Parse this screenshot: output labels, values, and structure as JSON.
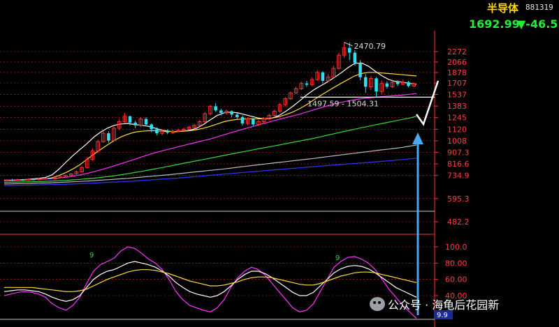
{
  "header": {
    "name": "半导体",
    "code": "881319",
    "price": "1692.99",
    "change": "▼-46.5"
  },
  "watermark": {
    "text": "公众号 · 海龟后花园新"
  },
  "colors": {
    "up": "#ff3333",
    "down": "#33ddee",
    "grid": "#ff3333",
    "axis_text": "#ff4040",
    "ma_white": "#ffffff",
    "ma_yellow": "#ffdd33",
    "ma_magenta": "#ff33ff",
    "ma_green": "#33dd33",
    "ma_gray": "#bbbbbb",
    "ma_blue": "#3333ff",
    "arrow": "#4aa8f0"
  },
  "chart_data": {
    "type": "candlestick",
    "price_axis": {
      "scale": "log",
      "ticks": [
        "2272",
        "2066",
        "1878",
        "1707",
        "1537",
        "1383",
        "1245",
        "1120",
        "1008",
        "907.3",
        "816.6",
        "734.9",
        "595.3",
        "482.2"
      ]
    },
    "annotations": {
      "high_label": "2470.79",
      "range_label": "1497.59 - 1504.31",
      "support_level": 1500,
      "support_line_label": "1537"
    },
    "candles": [
      {
        "o": 700,
        "c": 705,
        "h": 710,
        "l": 695
      },
      {
        "o": 705,
        "c": 702,
        "h": 712,
        "l": 698
      },
      {
        "o": 702,
        "c": 708,
        "h": 714,
        "l": 699
      },
      {
        "o": 708,
        "c": 704,
        "h": 712,
        "l": 700
      },
      {
        "o": 704,
        "c": 710,
        "h": 716,
        "l": 701
      },
      {
        "o": 710,
        "c": 706,
        "h": 714,
        "l": 702
      },
      {
        "o": 706,
        "c": 712,
        "h": 718,
        "l": 703
      },
      {
        "o": 712,
        "c": 716,
        "h": 722,
        "l": 708
      },
      {
        "o": 716,
        "c": 713,
        "h": 720,
        "l": 710
      },
      {
        "o": 713,
        "c": 720,
        "h": 726,
        "l": 710
      },
      {
        "o": 720,
        "c": 726,
        "h": 732,
        "l": 716
      },
      {
        "o": 726,
        "c": 735,
        "h": 742,
        "l": 722
      },
      {
        "o": 735,
        "c": 745,
        "h": 752,
        "l": 730
      },
      {
        "o": 745,
        "c": 760,
        "h": 768,
        "l": 740
      },
      {
        "o": 760,
        "c": 790,
        "h": 800,
        "l": 755
      },
      {
        "o": 790,
        "c": 850,
        "h": 870,
        "l": 785
      },
      {
        "o": 850,
        "c": 920,
        "h": 940,
        "l": 840
      },
      {
        "o": 920,
        "c": 1000,
        "h": 1020,
        "l": 905
      },
      {
        "o": 1000,
        "c": 1080,
        "h": 1100,
        "l": 990
      },
      {
        "o": 1080,
        "c": 1010,
        "h": 1100,
        "l": 990
      },
      {
        "o": 1010,
        "c": 1130,
        "h": 1150,
        "l": 1000
      },
      {
        "o": 1130,
        "c": 1200,
        "h": 1230,
        "l": 1110
      },
      {
        "o": 1200,
        "c": 1260,
        "h": 1300,
        "l": 1180
      },
      {
        "o": 1260,
        "c": 1190,
        "h": 1270,
        "l": 1160
      },
      {
        "o": 1190,
        "c": 1160,
        "h": 1210,
        "l": 1130
      },
      {
        "o": 1160,
        "c": 1230,
        "h": 1250,
        "l": 1140
      },
      {
        "o": 1230,
        "c": 1170,
        "h": 1250,
        "l": 1150
      },
      {
        "o": 1170,
        "c": 1120,
        "h": 1180,
        "l": 1090
      },
      {
        "o": 1120,
        "c": 1080,
        "h": 1140,
        "l": 1060
      },
      {
        "o": 1080,
        "c": 1100,
        "h": 1120,
        "l": 1060
      },
      {
        "o": 1100,
        "c": 1085,
        "h": 1120,
        "l": 1070
      },
      {
        "o": 1085,
        "c": 1100,
        "h": 1115,
        "l": 1075
      },
      {
        "o": 1100,
        "c": 1110,
        "h": 1125,
        "l": 1090
      },
      {
        "o": 1110,
        "c": 1120,
        "h": 1135,
        "l": 1100
      },
      {
        "o": 1120,
        "c": 1140,
        "h": 1155,
        "l": 1110
      },
      {
        "o": 1140,
        "c": 1160,
        "h": 1175,
        "l": 1130
      },
      {
        "o": 1160,
        "c": 1200,
        "h": 1220,
        "l": 1150
      },
      {
        "o": 1200,
        "c": 1290,
        "h": 1310,
        "l": 1190
      },
      {
        "o": 1290,
        "c": 1380,
        "h": 1400,
        "l": 1270
      },
      {
        "o": 1380,
        "c": 1330,
        "h": 1420,
        "l": 1310
      },
      {
        "o": 1330,
        "c": 1300,
        "h": 1350,
        "l": 1270
      },
      {
        "o": 1300,
        "c": 1320,
        "h": 1340,
        "l": 1280
      },
      {
        "o": 1320,
        "c": 1280,
        "h": 1330,
        "l": 1250
      },
      {
        "o": 1280,
        "c": 1250,
        "h": 1300,
        "l": 1220
      },
      {
        "o": 1250,
        "c": 1180,
        "h": 1270,
        "l": 1160
      },
      {
        "o": 1180,
        "c": 1230,
        "h": 1250,
        "l": 1160
      },
      {
        "o": 1230,
        "c": 1170,
        "h": 1240,
        "l": 1150
      },
      {
        "o": 1170,
        "c": 1200,
        "h": 1220,
        "l": 1150
      },
      {
        "o": 1200,
        "c": 1230,
        "h": 1250,
        "l": 1180
      },
      {
        "o": 1230,
        "c": 1270,
        "h": 1290,
        "l": 1210
      },
      {
        "o": 1270,
        "c": 1320,
        "h": 1340,
        "l": 1250
      },
      {
        "o": 1320,
        "c": 1400,
        "h": 1420,
        "l": 1300
      },
      {
        "o": 1400,
        "c": 1480,
        "h": 1500,
        "l": 1380
      },
      {
        "o": 1480,
        "c": 1560,
        "h": 1580,
        "l": 1460
      },
      {
        "o": 1560,
        "c": 1620,
        "h": 1650,
        "l": 1540
      },
      {
        "o": 1620,
        "c": 1700,
        "h": 1730,
        "l": 1600
      },
      {
        "o": 1700,
        "c": 1680,
        "h": 1740,
        "l": 1650
      },
      {
        "o": 1680,
        "c": 1760,
        "h": 1800,
        "l": 1660
      },
      {
        "o": 1760,
        "c": 1880,
        "h": 1920,
        "l": 1740
      },
      {
        "o": 1880,
        "c": 1740,
        "h": 1900,
        "l": 1700
      },
      {
        "o": 1740,
        "c": 1800,
        "h": 1850,
        "l": 1720
      },
      {
        "o": 1800,
        "c": 1950,
        "h": 2000,
        "l": 1780
      },
      {
        "o": 1950,
        "c": 2200,
        "h": 2250,
        "l": 1930
      },
      {
        "o": 2200,
        "c": 2350,
        "h": 2470,
        "l": 2150
      },
      {
        "o": 2350,
        "c": 2250,
        "h": 2470,
        "l": 2100
      },
      {
        "o": 2250,
        "c": 2050,
        "h": 2300,
        "l": 2000
      },
      {
        "o": 2050,
        "c": 1800,
        "h": 2100,
        "l": 1750
      },
      {
        "o": 1800,
        "c": 1650,
        "h": 1850,
        "l": 1560
      },
      {
        "o": 1650,
        "c": 1780,
        "h": 1820,
        "l": 1600
      },
      {
        "o": 1780,
        "c": 1580,
        "h": 1800,
        "l": 1510
      },
      {
        "o": 1580,
        "c": 1700,
        "h": 1750,
        "l": 1540
      },
      {
        "o": 1700,
        "c": 1650,
        "h": 1730,
        "l": 1620
      },
      {
        "o": 1650,
        "c": 1720,
        "h": 1760,
        "l": 1630
      },
      {
        "o": 1720,
        "c": 1690,
        "h": 1750,
        "l": 1660
      },
      {
        "o": 1690,
        "c": 1720,
        "h": 1760,
        "l": 1670
      },
      {
        "o": 1720,
        "c": 1660,
        "h": 1740,
        "l": 1640
      },
      {
        "o": 1660,
        "c": 1693,
        "h": 1710,
        "l": 1640
      }
    ],
    "moving_averages": [
      {
        "color": "white",
        "values": [
          700,
          704,
          706,
          708,
          712,
          716,
          722,
          740,
          780,
          830,
          880,
          930,
          980,
          1040,
          1090,
          1130,
          1160,
          1175,
          1180,
          1170,
          1160,
          1150,
          1130,
          1110,
          1100,
          1095,
          1100,
          1110,
          1130,
          1170,
          1220,
          1270,
          1300,
          1310,
          1300,
          1280,
          1260,
          1240,
          1230,
          1240,
          1270,
          1320,
          1380,
          1450,
          1530,
          1600,
          1660,
          1720,
          1790,
          1870,
          1960,
          2040,
          2050,
          1990,
          1900,
          1820,
          1760,
          1730,
          1720,
          1700,
          1690
        ]
      },
      {
        "color": "yellow",
        "values": [
          700,
          702,
          703,
          705,
          707,
          709,
          712,
          720,
          735,
          755,
          780,
          810,
          850,
          890,
          930,
          970,
          1010,
          1045,
          1070,
          1090,
          1100,
          1105,
          1105,
          1100,
          1098,
          1098,
          1100,
          1105,
          1115,
          1130,
          1150,
          1175,
          1200,
          1215,
          1225,
          1230,
          1232,
          1232,
          1232,
          1240,
          1255,
          1280,
          1310,
          1350,
          1400,
          1460,
          1520,
          1580,
          1640,
          1700,
          1760,
          1820,
          1860,
          1880,
          1880,
          1870,
          1860,
          1850,
          1840,
          1830,
          1820
        ]
      },
      {
        "color": "magenta",
        "values": [
          705,
          705,
          706,
          707,
          708,
          709,
          711,
          714,
          718,
          723,
          730,
          738,
          748,
          760,
          773,
          787,
          802,
          818,
          835,
          852,
          870,
          888,
          905,
          920,
          935,
          950,
          965,
          980,
          995,
          1010,
          1025,
          1045,
          1065,
          1085,
          1105,
          1125,
          1145,
          1165,
          1185,
          1205,
          1225,
          1245,
          1265,
          1285,
          1310,
          1335,
          1360,
          1385,
          1410,
          1430,
          1450,
          1465,
          1480,
          1490,
          1500,
          1508,
          1515,
          1522,
          1530,
          1540,
          1550
        ]
      },
      {
        "color": "green",
        "values": [
          690,
          691,
          692,
          693,
          694,
          695,
          697,
          699,
          701,
          703,
          706,
          709,
          713,
          717,
          722,
          727,
          733,
          740,
          747,
          755,
          763,
          772,
          781,
          790,
          800,
          810,
          820,
          830,
          840,
          850,
          860,
          871,
          882,
          893,
          904,
          915,
          926,
          937,
          948,
          959,
          970,
          982,
          994,
          1006,
          1018,
          1030,
          1045,
          1060,
          1075,
          1090,
          1105,
          1120,
          1135,
          1150,
          1165,
          1180,
          1195,
          1210,
          1225,
          1240,
          1260
        ]
      },
      {
        "color": "gray",
        "values": [
          680,
          681,
          682,
          683,
          684,
          685,
          686,
          688,
          690,
          692,
          694,
          696,
          698,
          701,
          704,
          707,
          710,
          713,
          716,
          720,
          724,
          728,
          732,
          736,
          740,
          745,
          750,
          755,
          760,
          765,
          770,
          775,
          780,
          786,
          792,
          798,
          804,
          810,
          816,
          822,
          828,
          834,
          840,
          846,
          852,
          858,
          865,
          872,
          879,
          886,
          893,
          900,
          907,
          914,
          921,
          928,
          935,
          942,
          950,
          960,
          970
        ]
      },
      {
        "color": "blue",
        "values": [
          670,
          671,
          672,
          673,
          674,
          675,
          676,
          677,
          678,
          679,
          680,
          682,
          684,
          686,
          688,
          690,
          692,
          694,
          696,
          699,
          702,
          705,
          708,
          711,
          714,
          717,
          720,
          724,
          728,
          732,
          736,
          740,
          744,
          748,
          752,
          756,
          760,
          764,
          768,
          772,
          776,
          780,
          784,
          788,
          792,
          796,
          800,
          804,
          808,
          812,
          816,
          820,
          824,
          828,
          832,
          836,
          840,
          845,
          850,
          855,
          860
        ]
      }
    ],
    "oscillator": {
      "ticks": [
        "100.0",
        "80.00",
        "60.00",
        "40.00"
      ],
      "label_low": "9.9",
      "peak_marker": "9",
      "lines": [
        {
          "color": "magenta",
          "values": [
            40,
            42,
            44,
            45,
            44,
            42,
            38,
            30,
            25,
            22,
            28,
            38,
            55,
            70,
            78,
            82,
            86,
            95,
            100,
            98,
            92,
            85,
            80,
            72,
            60,
            45,
            35,
            28,
            25,
            22,
            20,
            25,
            35,
            50,
            62,
            70,
            75,
            72,
            65,
            55,
            45,
            35,
            25,
            20,
            22,
            30,
            45,
            60,
            75,
            82,
            87,
            88,
            85,
            80,
            72,
            60,
            48,
            38,
            28,
            20,
            12
          ]
        },
        {
          "color": "white",
          "values": [
            45,
            46,
            47,
            47,
            46,
            45,
            42,
            38,
            35,
            33,
            35,
            40,
            50,
            60,
            66,
            70,
            72,
            76,
            80,
            82,
            80,
            78,
            75,
            70,
            64,
            56,
            50,
            45,
            42,
            40,
            38,
            40,
            45,
            52,
            60,
            66,
            70,
            70,
            67,
            62,
            56,
            50,
            44,
            40,
            40,
            44,
            52,
            60,
            68,
            73,
            76,
            77,
            76,
            73,
            68,
            62,
            56,
            50,
            46,
            42,
            38
          ]
        },
        {
          "color": "yellow",
          "values": [
            50,
            50,
            50,
            50,
            50,
            49,
            48,
            47,
            46,
            45,
            45,
            46,
            48,
            52,
            56,
            60,
            63,
            66,
            69,
            71,
            72,
            72,
            71,
            69,
            67,
            64,
            61,
            58,
            56,
            54,
            52,
            52,
            53,
            55,
            57,
            60,
            62,
            63,
            63,
            62,
            60,
            58,
            56,
            54,
            53,
            53,
            55,
            58,
            61,
            64,
            66,
            68,
            69,
            69,
            68,
            66,
            64,
            62,
            60,
            58,
            56
          ]
        }
      ]
    }
  }
}
